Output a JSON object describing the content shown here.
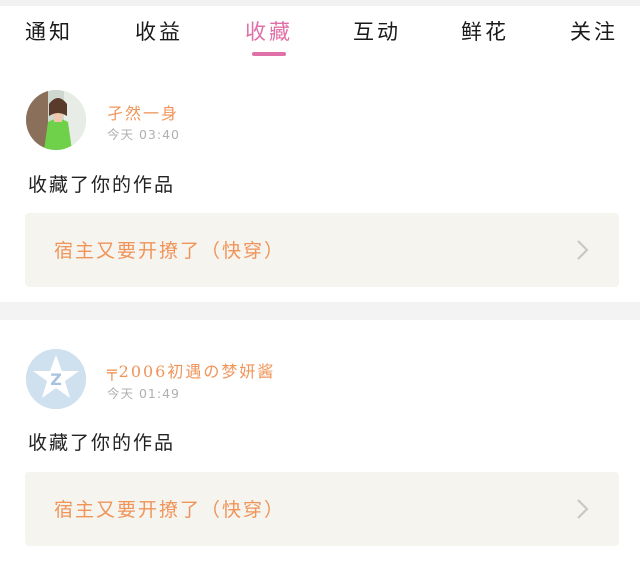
{
  "tabs": [
    {
      "label": "通知",
      "active": false
    },
    {
      "label": "收益",
      "active": false
    },
    {
      "label": "收藏",
      "active": true
    },
    {
      "label": "互动",
      "active": false
    },
    {
      "label": "鲜花",
      "active": false
    },
    {
      "label": "关注",
      "active": false
    }
  ],
  "colors": {
    "accent": "#e070a8",
    "name": "#f0945a",
    "work_box_bg": "#f5f4ee",
    "time": "#b0b0b0"
  },
  "notifications": [
    {
      "user_name": "孑然一身",
      "time": "今天 03:40",
      "action": "收藏了你的作品",
      "work_title": "宿主又要开撩了（快穿）",
      "avatar": "photo-avatar-icon"
    },
    {
      "user_name": "╤2006初遇の梦妍酱",
      "time": "今天 01:49",
      "action": "收藏了你的作品",
      "work_title": "宿主又要开撩了（快穿）",
      "avatar": "default-z-avatar-icon"
    }
  ]
}
